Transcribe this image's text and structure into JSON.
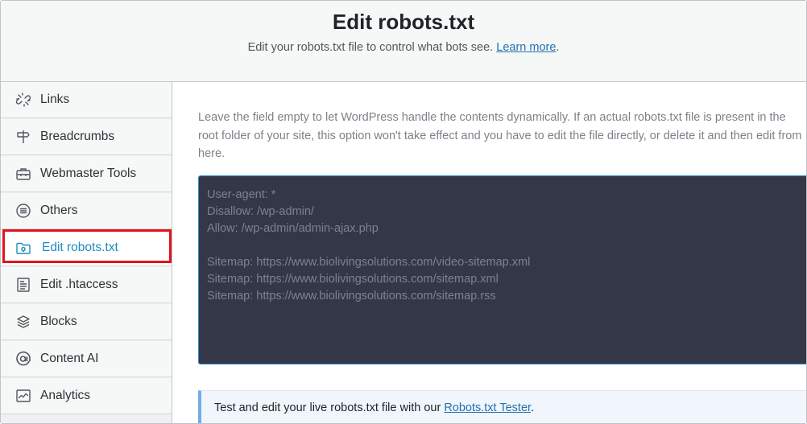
{
  "header": {
    "title": "Edit robots.txt",
    "subtitle_text": "Edit your robots.txt file to control what bots see.",
    "learn_more": "Learn more",
    "period": "."
  },
  "sidebar": {
    "items": [
      {
        "label": "Links",
        "icon": "link-icon"
      },
      {
        "label": "Breadcrumbs",
        "icon": "signpost-icon"
      },
      {
        "label": "Webmaster Tools",
        "icon": "toolbox-icon"
      },
      {
        "label": "Others",
        "icon": "list-circle-icon"
      },
      {
        "label": "Edit robots.txt",
        "icon": "folder-robot-icon",
        "active": true
      },
      {
        "label": "Edit .htaccess",
        "icon": "file-text-icon"
      },
      {
        "label": "Blocks",
        "icon": "blocks-icon"
      },
      {
        "label": "Content AI",
        "icon": "content-ai-icon"
      },
      {
        "label": "Analytics",
        "icon": "analytics-icon"
      }
    ]
  },
  "main": {
    "description": "Leave the field empty to let WordPress handle the contents dynamically. If an actual robots.txt file is present in the root folder of your site, this option won't take effect and you have to edit the file directly, or delete it and then edit from here.",
    "editor_lines": [
      "User-agent: *",
      "Disallow: /wp-admin/",
      "Allow: /wp-admin/admin-ajax.php",
      "",
      "Sitemap: https://www.biolivingsolutions.com/video-sitemap.xml",
      "Sitemap: https://www.biolivingsolutions.com/sitemap.xml",
      "Sitemap: https://www.biolivingsolutions.com/sitemap.rss"
    ],
    "notice_text": "Test and edit your live robots.txt file with our",
    "notice_link": "Robots.txt Tester",
    "notice_end": "."
  },
  "colors": {
    "accent": "#1e8cbe",
    "highlight": "#e0141e",
    "editor_bg": "#343747"
  }
}
